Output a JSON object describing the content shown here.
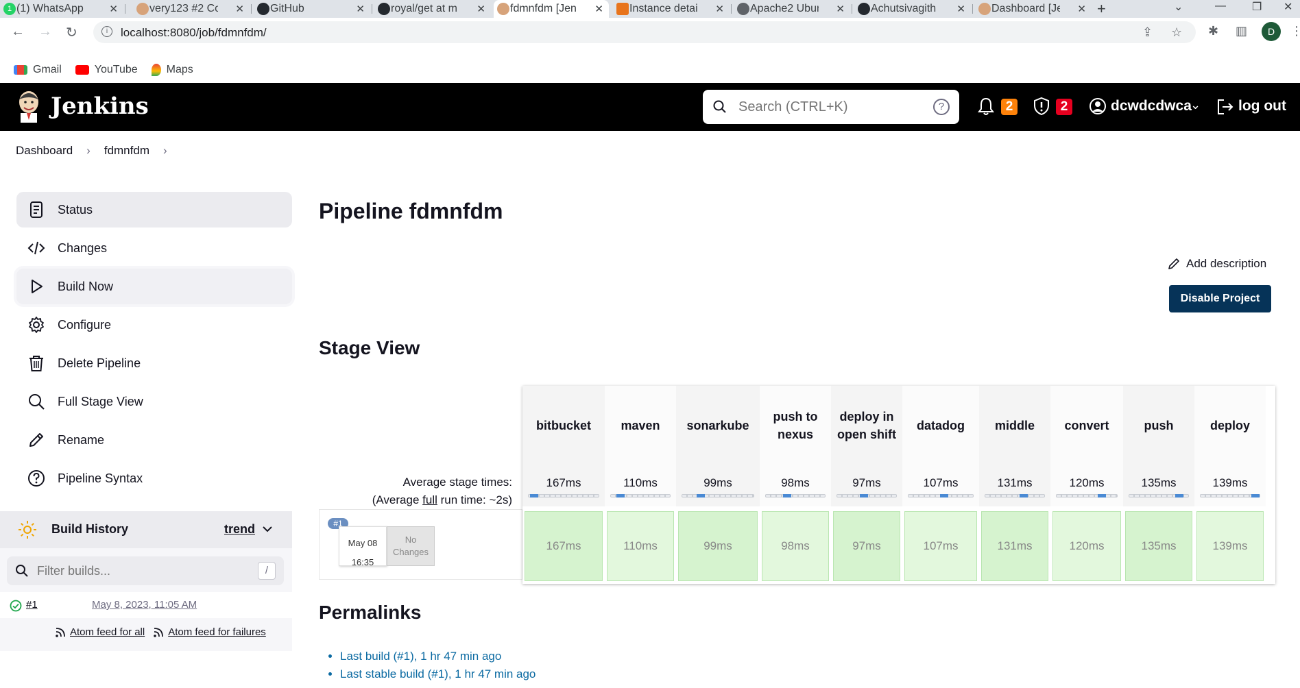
{
  "browser": {
    "tabs": [
      {
        "title": "(1) WhatsApp",
        "favicon": "whatsapp-icon"
      },
      {
        "title": "very123 #2 Co",
        "favicon": "jenkins-icon"
      },
      {
        "title": "GitHub",
        "favicon": "github-icon"
      },
      {
        "title": "royal/get at m",
        "favicon": "github-icon"
      },
      {
        "title": "fdmnfdm [Jen",
        "favicon": "jenkins-icon",
        "active": true
      },
      {
        "title": "Instance detai",
        "favicon": "aws-icon"
      },
      {
        "title": "Apache2 Ubun",
        "favicon": "globe-icon"
      },
      {
        "title": "Achutsivagith",
        "favicon": "github-icon"
      },
      {
        "title": "Dashboard [Je",
        "favicon": "jenkins-icon"
      }
    ],
    "url": "localhost:8080/job/fdmnfdm/",
    "profile_initial": "D",
    "bookmarks": [
      {
        "label": "Gmail",
        "icon": "gmail-icon"
      },
      {
        "label": "YouTube",
        "icon": "youtube-icon"
      },
      {
        "label": "Maps",
        "icon": "maps-icon"
      }
    ],
    "whatsapp_badge": "1"
  },
  "header": {
    "brand": "Jenkins",
    "search_placeholder": "Search (CTRL+K)",
    "notifications_count": "2",
    "security_count": "2",
    "username": "dcwdcdwca",
    "logout": "log out",
    "colors": {
      "bar": "#000000",
      "notif_badge": "#fe820a",
      "security_badge": "#e6001f"
    }
  },
  "breadcrumb": [
    "Dashboard",
    "fdmnfdm"
  ],
  "sidebar": {
    "items": [
      {
        "label": "Status",
        "icon": "notepad-icon"
      },
      {
        "label": "Changes",
        "icon": "code-icon"
      },
      {
        "label": "Build Now",
        "icon": "play-icon"
      },
      {
        "label": "Configure",
        "icon": "gear-icon"
      },
      {
        "label": "Delete Pipeline",
        "icon": "trash-icon"
      },
      {
        "label": "Full Stage View",
        "icon": "search-icon"
      },
      {
        "label": "Rename",
        "icon": "pencil-icon"
      },
      {
        "label": "Pipeline Syntax",
        "icon": "help-icon"
      }
    ]
  },
  "build_history": {
    "title": "Build History",
    "trend": "trend",
    "filter_placeholder": "Filter builds...",
    "filter_shortcut": "/",
    "builds": [
      {
        "number": "#1",
        "date": "May 8, 2023, 11:05 AM",
        "status": "success"
      }
    ],
    "feed_all": "Atom feed for all",
    "feed_failures": "Atom feed for failures"
  },
  "main": {
    "title": "Pipeline fdmnfdm",
    "add_description": "Add description",
    "disable_project": "Disable Project",
    "stage_view_title": "Stage View",
    "avg_stage_times": "Average stage times:",
    "avg_full_prefix": "(Average ",
    "avg_full_link": "full",
    "avg_full_suffix": " run time: ~2s)",
    "build": {
      "number": "#1",
      "month_day": "May 08",
      "time": "16:35",
      "changes_line1": "No",
      "changes_line2": "Changes"
    },
    "stages": [
      {
        "name": "bitbucket",
        "avg": "167ms",
        "run": "167ms",
        "bar_pos": 0.02
      },
      {
        "name": "maven",
        "avg": "110ms",
        "run": "110ms",
        "bar_pos": 0.1
      },
      {
        "name": "sonarkube",
        "avg": "99ms",
        "run": "99ms",
        "bar_pos": 0.22
      },
      {
        "name": "push to nexus",
        "avg": "98ms",
        "run": "98ms",
        "bar_pos": 0.33
      },
      {
        "name": "deploy in open shift",
        "avg": "97ms",
        "run": "97ms",
        "bar_pos": 0.44
      },
      {
        "name": "datadog",
        "avg": "107ms",
        "run": "107ms",
        "bar_pos": 0.55
      },
      {
        "name": "middle",
        "avg": "131ms",
        "run": "131ms",
        "bar_pos": 0.66
      },
      {
        "name": "convert",
        "avg": "120ms",
        "run": "120ms",
        "bar_pos": 0.77
      },
      {
        "name": "push",
        "avg": "135ms",
        "run": "135ms",
        "bar_pos": 0.88
      },
      {
        "name": "deploy",
        "avg": "139ms",
        "run": "139ms",
        "bar_pos": 0.98
      }
    ],
    "permalinks_title": "Permalinks",
    "permalinks": [
      "Last build (#1), 1 hr 47 min ago",
      "Last stable build (#1), 1 hr 47 min ago"
    ]
  }
}
